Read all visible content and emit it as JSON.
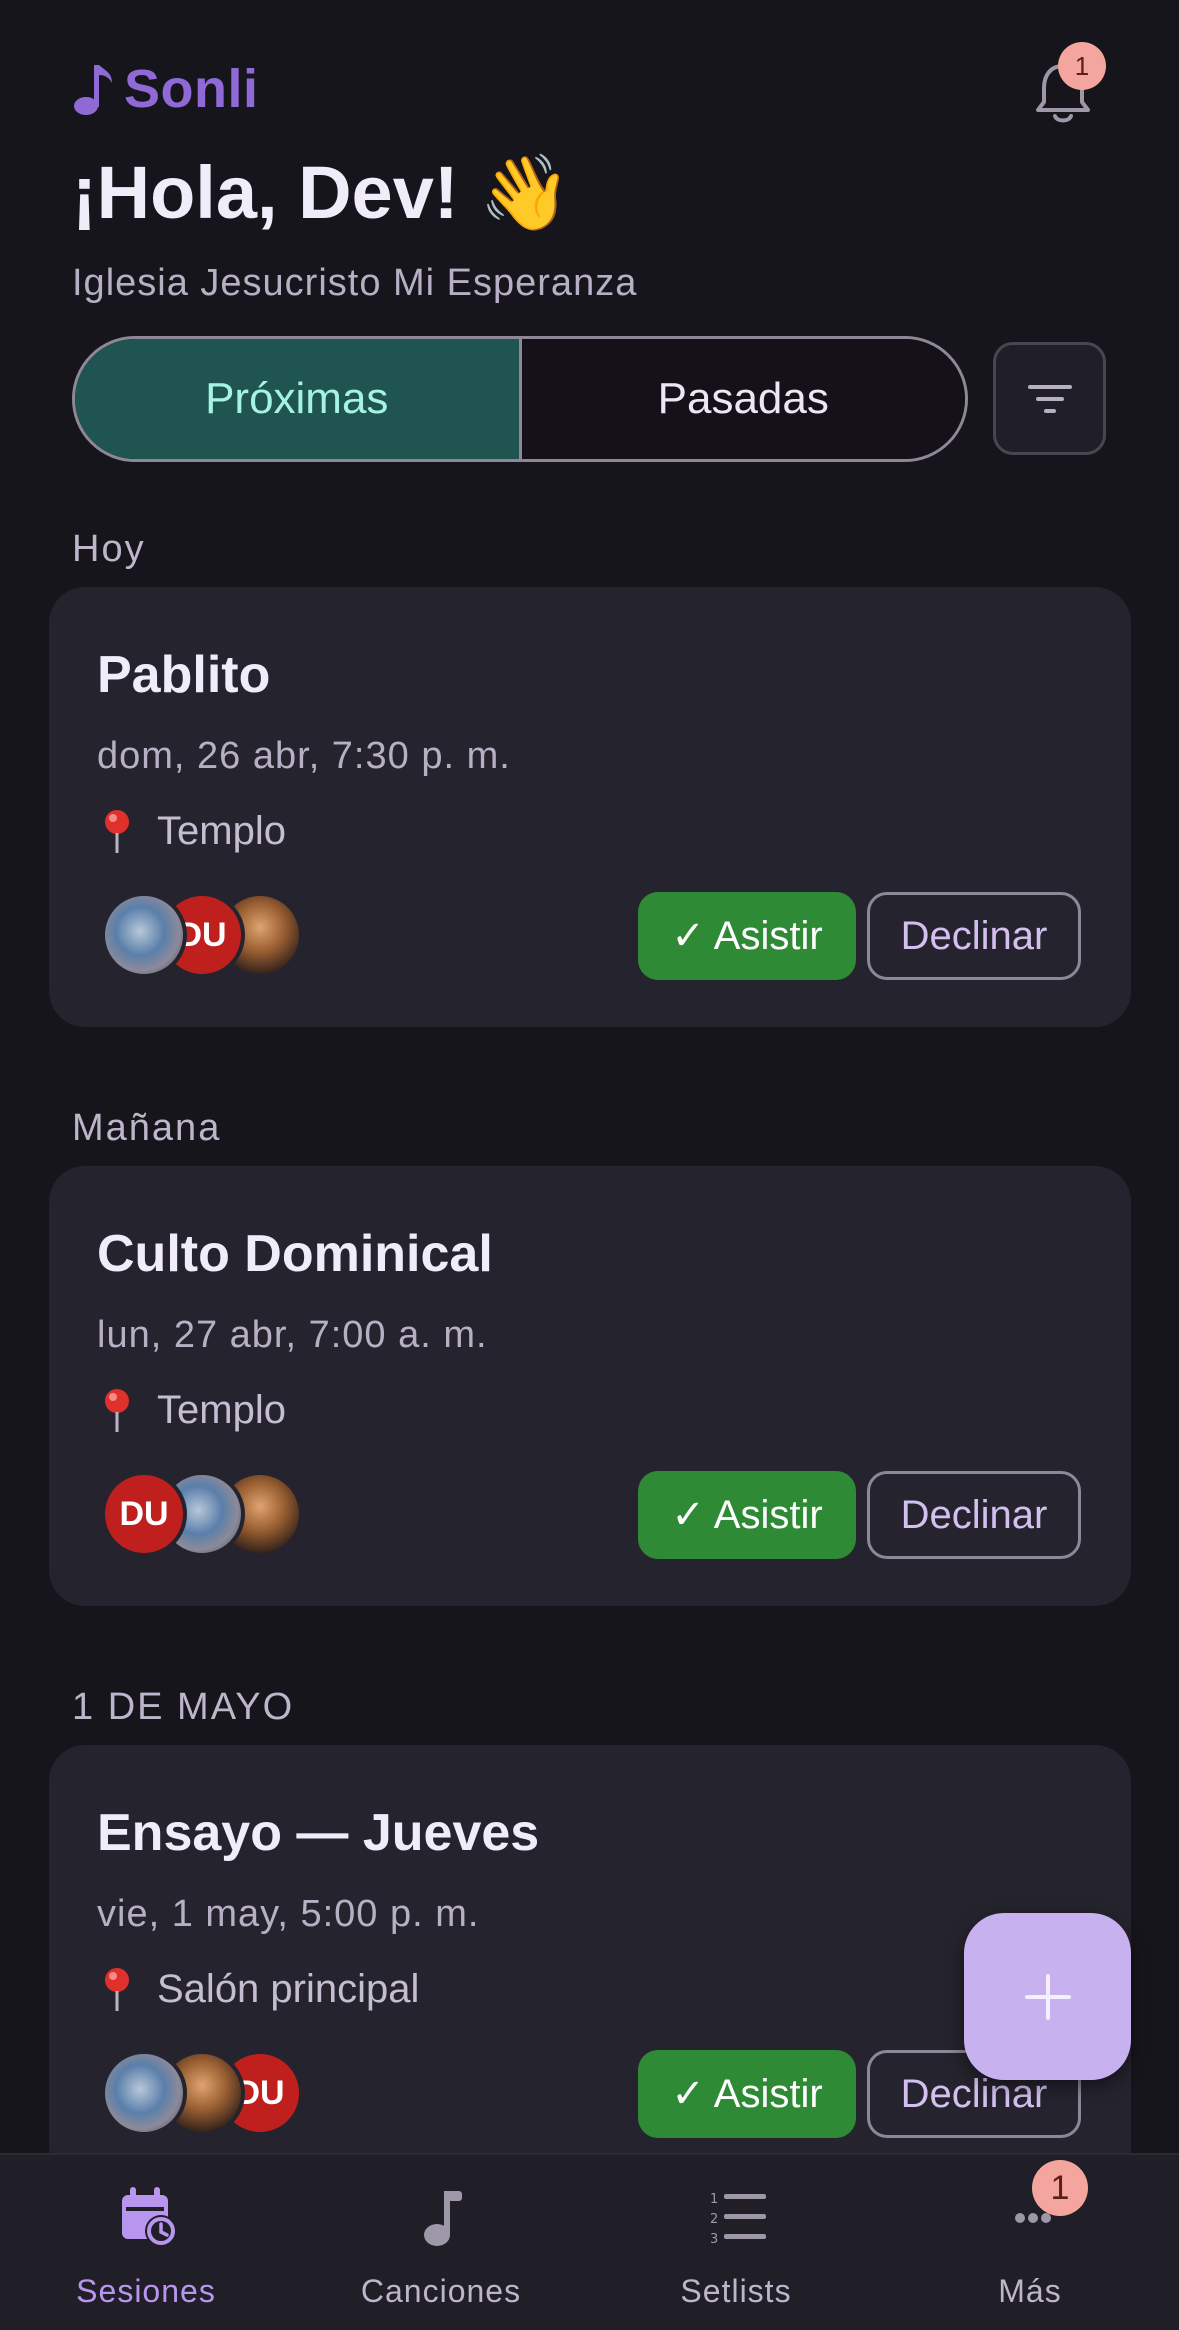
{
  "app": {
    "name": "Sonli",
    "brand_color": "#8f69d6",
    "notification_count": "1"
  },
  "header": {
    "greeting": "¡Hola, Dev! 👋",
    "church": "Iglesia Jesucristo Mi Esperanza"
  },
  "tabs": {
    "upcoming": "Próximas",
    "past": "Pasadas",
    "selected": "upcoming"
  },
  "sections": [
    {
      "label": "Hoy",
      "event": {
        "title": "Pablito",
        "datetime": "dom, 26 abr, 7:30 p. m.",
        "location": "Templo",
        "avatars": [
          "photo-globe",
          "DU",
          "photo-person"
        ],
        "attend_label": "✓ Asistir",
        "decline_label": "Declinar"
      }
    },
    {
      "label": "Mañana",
      "event": {
        "title": "Culto Dominical",
        "datetime": "lun, 27 abr, 7:00 a. m.",
        "location": "Templo",
        "avatars": [
          "DU",
          "photo-globe",
          "photo-person"
        ],
        "attend_label": "✓ Asistir",
        "decline_label": "Declinar"
      }
    },
    {
      "label": "1 DE MAYO",
      "event": {
        "title": "Ensayo — Jueves",
        "datetime": "vie, 1 may, 5:00 p. m.",
        "location": "Salón principal",
        "avatars": [
          "photo-globe",
          "photo-person",
          "DU"
        ],
        "attend_label": "✓ Asistir",
        "decline_label": "Declinar"
      }
    }
  ],
  "fab": {
    "icon": "plus-icon"
  },
  "bottom_nav": {
    "items": [
      {
        "label": "Sesiones",
        "icon": "calendar-clock-icon",
        "active": true
      },
      {
        "label": "Canciones",
        "icon": "music-note-icon",
        "active": false
      },
      {
        "label": "Setlists",
        "icon": "numbered-list-icon",
        "active": false
      },
      {
        "label": "Más",
        "icon": "more-icon",
        "active": false
      }
    ],
    "more_badge": "1"
  },
  "colors": {
    "background": "#17151c",
    "card": "#25232d",
    "accent_teal": "#1f5451",
    "attend_green": "#2e8a35",
    "fab": "#c7b1ef",
    "badge": "#f4a59d"
  }
}
